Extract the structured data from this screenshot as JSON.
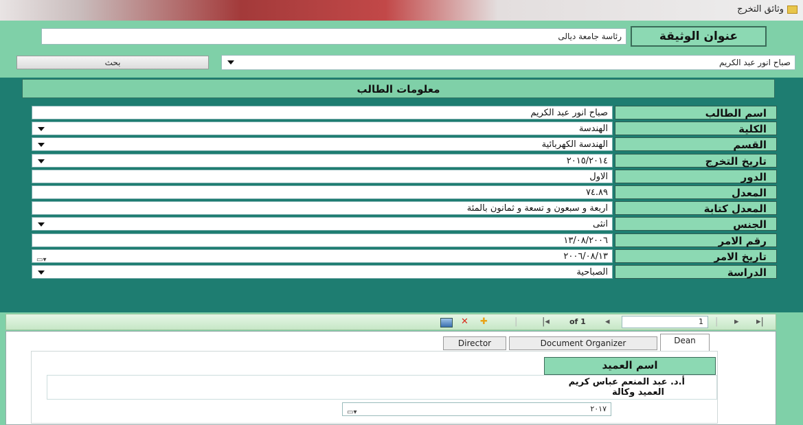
{
  "window": {
    "title": "وثائق التخرج",
    "icon": "folder-icon"
  },
  "top": {
    "doc_title_label": "عنوان الوثيقة",
    "doc_title_value": "رئاسة جامعة ديالى",
    "search_button": "بحث",
    "student_select_value": "صباح انور عبد الكريم"
  },
  "student_info": {
    "header": "معلومات الطالب",
    "fields": [
      {
        "label": "اسم الطالب",
        "value": "صباح انور عبد الكريم",
        "control": "text"
      },
      {
        "label": "الكلية",
        "value": "الهندسة",
        "control": "dropdown"
      },
      {
        "label": "القسم",
        "value": "الهندسة الكهربائية",
        "control": "dropdown"
      },
      {
        "label": "تاريخ التخرج",
        "value": "٢٠١٥/٢٠١٤",
        "control": "dropdown"
      },
      {
        "label": "الدور",
        "value": "الاول",
        "control": "text"
      },
      {
        "label": "المعدل",
        "value": "٧٤.٨٩",
        "control": "text"
      },
      {
        "label": "المعدل كتابة",
        "value": "اربعة و سبعون و تسعة و ثمانون بالمئة",
        "control": "text"
      },
      {
        "label": "الجنس",
        "value": "انثى",
        "control": "dropdown"
      },
      {
        "label": "رقم الامر",
        "value": "١٣/٠٨/٢٠٠٦",
        "control": "text"
      },
      {
        "label": "تاريخ الامر",
        "value": "٢٠٠٦/٠٨/١٣",
        "control": "date"
      },
      {
        "label": "الدراسة",
        "value": "الصباحية",
        "control": "dropdown"
      }
    ]
  },
  "toolbar": {
    "page_of": "of 1",
    "page_number": "1"
  },
  "tabs": [
    "Director",
    "Document Organizer",
    "Dean"
  ],
  "dean": {
    "label": "اسم العميد",
    "name_line1": "أ.د. عبد المنعم عباس كريم",
    "name_line2": "العميد وكالة",
    "date_value": "٢٠١٧"
  }
}
